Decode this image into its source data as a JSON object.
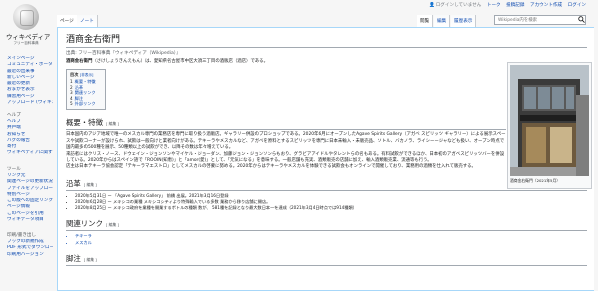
{
  "logo": {
    "wordmark": "ウィキペディア",
    "tagline": "フリー百科事典"
  },
  "sidebar": {
    "main": [
      "メインページ",
      "コミュニティ・ポータル",
      "最近の出来事",
      "新しいページ",
      "最近の更新",
      "おまかせ表示",
      "練習用ページ",
      "アップロード (ウィキメディア・コモンズ)"
    ],
    "help_heading": "ヘルプ",
    "help": [
      "ヘルプ",
      "井戸端",
      "お知らせ",
      "バグの報告",
      "寄付",
      "ウィキペディアに関するお問い合わせ"
    ],
    "tools_heading": "ツール",
    "tools": [
      "リンク元",
      "関連ページの更新状況",
      "ファイルをアップロード",
      "特別ページ",
      "この版への固定リンク",
      "ページ情報",
      "このページを引用",
      "ウィキデータ項目"
    ],
    "print_heading": "印刷/書き出し",
    "print": [
      "ブックの新規作成",
      "PDF 形式でダウンロード",
      "印刷用バージョン"
    ]
  },
  "personal": {
    "not_logged_in": "ログインしていません",
    "items": [
      "トーク",
      "投稿記録",
      "アカウント作成",
      "ログイン"
    ]
  },
  "tabs": {
    "page": "ページ",
    "talk": "ノート",
    "read": "閲覧",
    "edit": "編集",
    "history": "履歴表示"
  },
  "search": {
    "placeholder": "Wikipedia内を検索"
  },
  "article": {
    "title": "酒商金右衛門",
    "site_sub": "出典: フリー百科事典『ウィキペディア（Wikipedia）』",
    "lead_bold": "酒商金右衛門",
    "lead_reading": "（さけしょうきんえもん）",
    "lead_rest": "は、愛知県名古屋市中区大須三丁目の酒販店（酒店）である。",
    "toc": {
      "title": "目次",
      "hide": "[非表示]",
      "items": [
        {
          "num": "1",
          "label": "概要・特徴"
        },
        {
          "num": "2",
          "label": "沿革"
        },
        {
          "num": "3",
          "label": "関連リンク"
        },
        {
          "num": "4",
          "label": "脚注"
        },
        {
          "num": "5",
          "label": "外部リンク"
        }
      ]
    },
    "sections": {
      "overview": "概要・特徴",
      "history": "沿革",
      "related": "関連リンク",
      "notes": "脚注",
      "edit": "[ 編集 ]"
    },
    "overview_lines": [
      "日本国内のアジア地域で唯一のメスカル専門の業務店を専門に取り扱う酒販店。ギャラリー併設のプロショップである。2020年6月にオープンしたAgave Spirits Gallery（アガベ スピリッツ ギャラリー）による展示スペースや試飲コーナーが設けられ、試飲は一般向けと業者向けがある。テキーラやメスカルなど、アガベを原料とするスピリッツを専門に日本未輸入・未販売品、ソトル、バカノラ、ライシーージャなども扱い、オープン時点で国内最多の500種を展示、50種類以上の試飲ができ、以降その数は年々増えている。",
      "来訪者にはクリス・ノース、ドウェイン・ジョンソンやマイケル・ジョーダン、加藤ジョン・ジョンソンらもおり、グラビアアイドルやタレントらの名もある。有料試飲ができるほか、日本初のアガベスピリッツバーを併設している。2020年からはスペイン語で「ROOIN(知恵)」と「amor(愛)」として、「元気になる」を意味する。一般店舗も充実、酒類販売の店舗に加え、輸入酒類販売業、流通等も行う。",
      "店主は日本テキーラ協会認定「テキーラマエストロ」としてメスカルの啓蒙に努める。2020年からはテキーラやメスカルを体験できる試飲会もオンラインで開催しており、業務用の酒類を仕入れて販売する。"
    ],
    "history_items": [
      "2020年5月31日 ー 「Agave Spirits Gallery」 前橋 出展。2021年3月16日登録",
      "2020年6月28日 ー メキシコの業種 メキシコシティより特殊輸入でいる多数 業務から移り店舗に開店。",
      "2020年8月25日 ー メキシコ政府を業種を開業するボトルの種類 数が、 581種を記録となり最大数日本一を達成（2021年3月4日時点では914種類）"
    ],
    "related_items": [
      "テキーラ",
      "メスカル"
    ],
    "thumb_caption": "酒商金右衛門（2021年5月）"
  }
}
